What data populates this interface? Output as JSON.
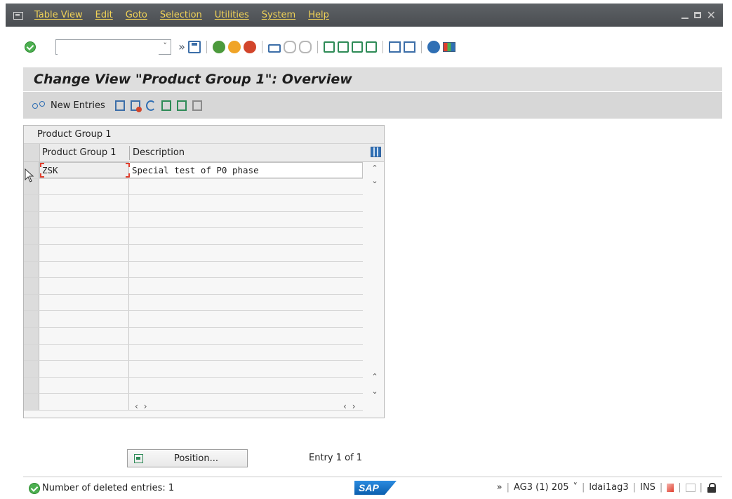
{
  "menu": {
    "items": [
      "Table View",
      "Edit",
      "Goto",
      "Selection",
      "Utilities",
      "System",
      "Help"
    ]
  },
  "window_controls": {
    "minimize": "_",
    "maximize": "□",
    "close": "✕"
  },
  "toolbar": {
    "command_field_value": "",
    "icons": [
      "enter-icon",
      "command-dropdown-icon",
      "expand-icon",
      "save-icon",
      "back-icon",
      "exit-icon",
      "cancel-icon",
      "print-icon",
      "find-icon",
      "find-next-icon",
      "first-page-icon",
      "previous-page-icon",
      "next-page-icon",
      "last-page-icon",
      "create-session-icon",
      "shortcut-icon",
      "help-icon",
      "layout-icon"
    ]
  },
  "title": "Change View \"Product Group 1\": Overview",
  "app_toolbar": {
    "new_entries_label": "New Entries"
  },
  "table": {
    "caption": "Product Group 1",
    "columns": [
      "Product Group 1",
      "Description"
    ],
    "rows": [
      {
        "product_group": "ZSK",
        "description": "Special test of P0 phase"
      }
    ],
    "empty_rows": 14
  },
  "position_button_label": "Position...",
  "entry_count": "Entry 1 of 1",
  "status": {
    "message": "Number of deleted entries: 1",
    "logo_text": "SAP",
    "system": "AG3 (1) 205",
    "server": "ldai1ag3",
    "mode": "INS",
    "chevron": "»",
    "dropdown": "˅"
  },
  "colors": {
    "menubar": "#4a4d51",
    "menu_text": "#f0d257",
    "title_bar": "#dedede",
    "app_toolbar": "#d7d7d7",
    "ok_green": "#4caf50",
    "cursor_red": "#e03e2d"
  }
}
